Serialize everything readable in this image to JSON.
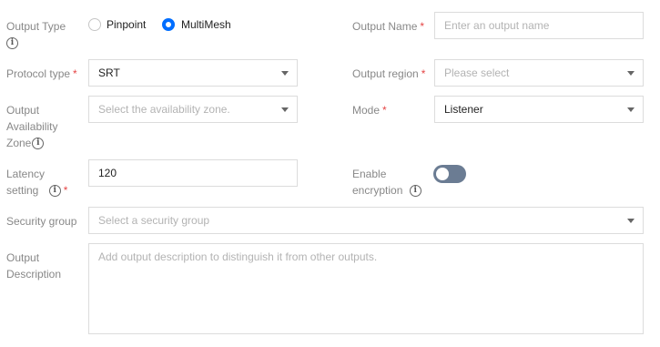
{
  "output_type": {
    "label": "Output Type",
    "options": [
      "Pinpoint",
      "MultiMesh"
    ],
    "selected": "MultiMesh"
  },
  "output_name": {
    "label": "Output Name",
    "required_mark": "*",
    "placeholder": "Enter an output name",
    "value": ""
  },
  "protocol_type": {
    "label": "Protocol type",
    "required_mark": "*",
    "value": "SRT"
  },
  "output_region": {
    "label": "Output region",
    "required_mark": "*",
    "placeholder": "Please select"
  },
  "availability_zone": {
    "label_lines": [
      "Output",
      "Availability",
      "Zone"
    ],
    "placeholder": "Select the availability zone."
  },
  "mode": {
    "label": "Mode",
    "required_mark": "*",
    "value": "Listener"
  },
  "latency": {
    "label_lines": [
      "Latency",
      "setting"
    ],
    "required_mark": "*",
    "value": "120"
  },
  "encryption": {
    "label_lines": [
      "Enable",
      "encryption"
    ],
    "enabled": false
  },
  "security_group": {
    "label": "Security group",
    "placeholder": "Select a security group"
  },
  "description": {
    "label_lines": [
      "Output",
      "Description"
    ],
    "placeholder": "Add output description to distinguish it from other outputs."
  },
  "icons": {
    "info": "info-icon",
    "dropdown": "chevron-down-icon"
  },
  "colors": {
    "accent": "#006eff",
    "required": "#e54545",
    "toggle_off": "#6b7c93"
  }
}
